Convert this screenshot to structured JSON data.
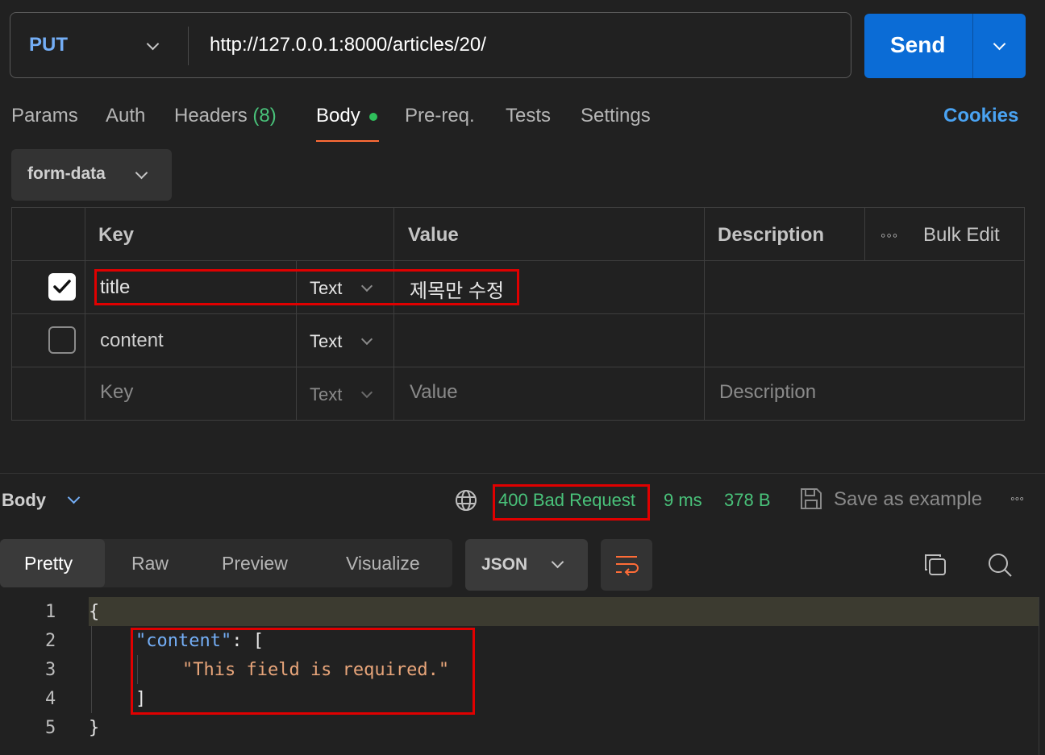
{
  "request": {
    "method": "PUT",
    "url": "http://127.0.0.1:8000/articles/20/",
    "send_label": "Send"
  },
  "tabs": {
    "params": "Params",
    "auth": "Auth",
    "headers": "Headers",
    "headers_count": "(8)",
    "body": "Body",
    "prereq": "Pre-req.",
    "tests": "Tests",
    "settings": "Settings",
    "cookies": "Cookies"
  },
  "body_mode": "form-data",
  "table": {
    "headers": {
      "key": "Key",
      "value": "Value",
      "description": "Description",
      "bulk_edit": "Bulk Edit"
    },
    "rows": [
      {
        "checked": true,
        "key": "title",
        "type": "Text",
        "value": "제목만 수정",
        "description": ""
      },
      {
        "checked": false,
        "key": "content",
        "type": "Text",
        "value": "",
        "description": ""
      }
    ],
    "placeholder": {
      "key": "Key",
      "type": "Text",
      "value": "Value",
      "description": "Description"
    }
  },
  "response": {
    "body_label": "Body",
    "status": "400 Bad Request",
    "time": "9 ms",
    "size": "378 B",
    "save_example": "Save as example",
    "views": {
      "pretty": "Pretty",
      "raw": "Raw",
      "preview": "Preview",
      "visualize": "Visualize"
    },
    "format": "JSON",
    "code": {
      "line_numbers": [
        "1",
        "2",
        "3",
        "4",
        "5"
      ],
      "open_brace": "{",
      "key": "\"content\"",
      "colon_bracket": ": [",
      "message": "\"This field is required.\"",
      "close_bracket": "]",
      "close_brace": "}"
    }
  },
  "colors": {
    "accent_blue": "#0b6cd6",
    "status_green": "#49c27a",
    "active_tab_underline": "#ff6c37",
    "highlight_red": "#e00000"
  }
}
